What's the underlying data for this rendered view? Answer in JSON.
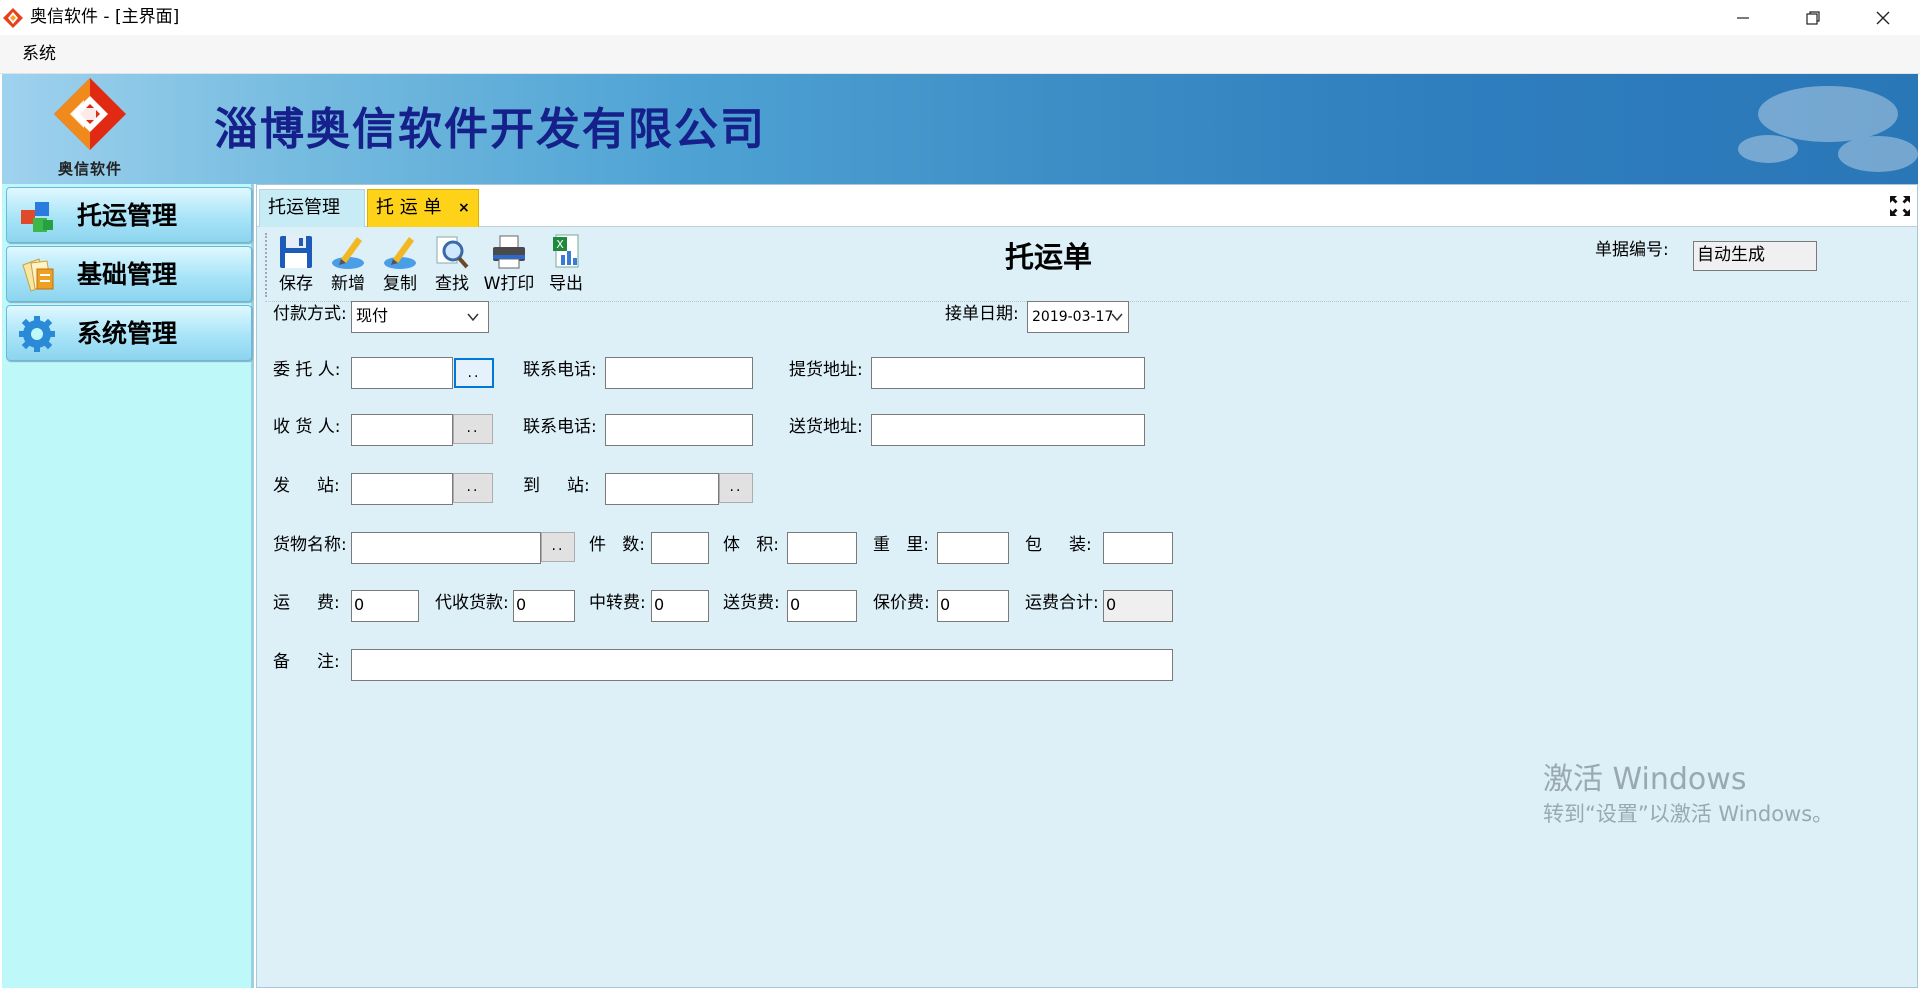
{
  "window": {
    "title": "奥信软件 - [主界面]",
    "menu": [
      "系统"
    ]
  },
  "banner": {
    "logo_text": "奥信软件",
    "company_name": "淄博奥信软件开发有限公司"
  },
  "sidebar": {
    "items": [
      {
        "label": "托运管理",
        "icon": "cubes-icon"
      },
      {
        "label": "基础管理",
        "icon": "documents-icon"
      },
      {
        "label": "系统管理",
        "icon": "gear-icon"
      }
    ]
  },
  "tabs": [
    {
      "label": "托运管理",
      "active": false
    },
    {
      "label": "托 运 单",
      "active": true,
      "close": "×"
    }
  ],
  "toolbar": {
    "buttons": [
      {
        "label": "保存",
        "icon": "floppy-disk-icon"
      },
      {
        "label": "新增",
        "icon": "new-pen-icon"
      },
      {
        "label": "复制",
        "icon": "copy-pen-icon"
      },
      {
        "label": "查找",
        "icon": "magnifier-icon"
      },
      {
        "label": "W打印",
        "icon": "printer-icon"
      },
      {
        "label": "导出",
        "icon": "excel-export-icon"
      }
    ]
  },
  "form": {
    "title": "托运单",
    "doc_no": {
      "label": "单据编号:",
      "value": "自动生成"
    },
    "payment": {
      "label": "付款方式:",
      "value": "现付"
    },
    "order_date": {
      "label": "接单日期:",
      "value": "2019-03-17"
    },
    "shipper": {
      "label": "委 托 人:",
      "value": "",
      "btn": ".."
    },
    "shipper_phone": {
      "label": "联系电话:",
      "value": ""
    },
    "pickup_addr": {
      "label": "提货地址:",
      "value": ""
    },
    "consignee": {
      "label": "收 货 人:",
      "value": "",
      "btn": ".."
    },
    "consignee_phone": {
      "label": "联系电话:",
      "value": ""
    },
    "delivery_addr": {
      "label": "送货地址:",
      "value": ""
    },
    "origin_station": {
      "label": "发     站:",
      "value": "",
      "btn": ".."
    },
    "dest_station": {
      "label": "到     站:",
      "value": "",
      "btn": ".."
    },
    "goods_name": {
      "label": "货物名称:",
      "value": "",
      "btn": ".."
    },
    "pieces": {
      "label": "件   数:",
      "value": ""
    },
    "volume": {
      "label": "体   积:",
      "value": ""
    },
    "weight": {
      "label": "重   里:",
      "value": ""
    },
    "packing": {
      "label": "包     装:",
      "value": ""
    },
    "freight": {
      "label": "运     费:",
      "value": "0"
    },
    "cod": {
      "label": "代收货款:",
      "value": "0"
    },
    "transfer_fee": {
      "label": "中转费:",
      "value": "0"
    },
    "delivery_fee": {
      "label": "送货费:",
      "value": "0"
    },
    "insurance_fee": {
      "label": "保价费:",
      "value": "0"
    },
    "freight_total": {
      "label": "运费合计:",
      "value": "0"
    },
    "remarks": {
      "label": "备     注:",
      "value": ""
    }
  },
  "watermark": {
    "line1": "激活 Windows",
    "line2": "转到“设置”以激活 Windows。"
  }
}
